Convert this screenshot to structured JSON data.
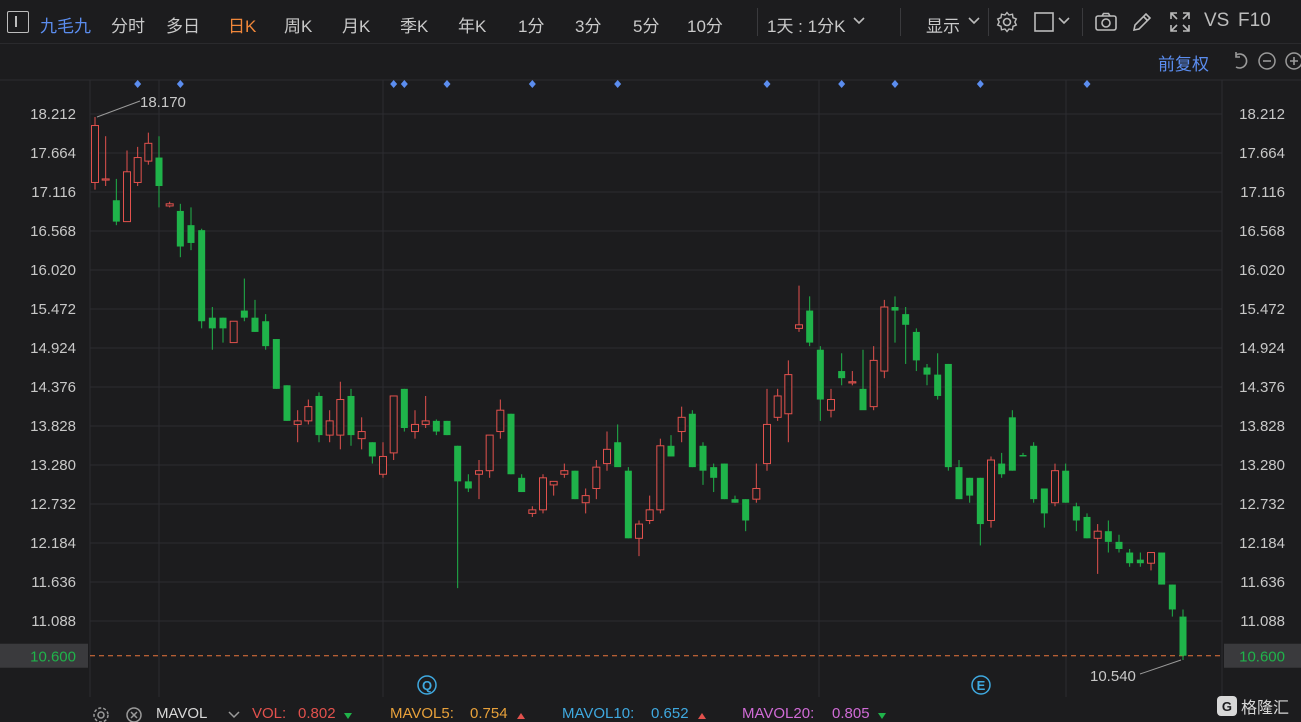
{
  "toolbar": {
    "stock_name": "九毛九",
    "periods": [
      "分时",
      "多日",
      "日K",
      "周K",
      "月K",
      "季K",
      "年K",
      "1分",
      "3分",
      "5分",
      "10分"
    ],
    "active_period": "日K",
    "combo_label": "1天 : 1分K",
    "display_label": "显示",
    "vs_label": "VS",
    "f10_label": "F10"
  },
  "subbar": {
    "adjust_label": "前复权"
  },
  "colors": {
    "up": "#e2514d",
    "down": "#1fb34a",
    "marker": "#5b8def",
    "accent": "#f0873a",
    "price_line": "#e8743b"
  },
  "icons": [
    "sidebar-toggle-icon",
    "chevron-down-icon",
    "gear-icon",
    "square-icon",
    "camera-icon",
    "pencil-icon",
    "fullscreen-icon",
    "undo-icon",
    "minus-circle-icon",
    "plus-circle-icon"
  ],
  "chart_data": {
    "type": "candlestick",
    "y_ticks": [
      "18.212",
      "17.664",
      "17.116",
      "16.568",
      "16.020",
      "15.472",
      "14.924",
      "14.376",
      "13.828",
      "13.280",
      "12.732",
      "12.184",
      "11.636",
      "11.088"
    ],
    "ylim": [
      10.5,
      18.6
    ],
    "last_price": "10.600",
    "high_label": "18.170",
    "low_label": "10.540",
    "event_markers": [
      "Q",
      "E"
    ],
    "candles": [
      {
        "o": 17.25,
        "h": 18.17,
        "l": 17.15,
        "c": 18.05
      },
      {
        "o": 17.3,
        "h": 17.9,
        "l": 17.2,
        "c": 17.3
      },
      {
        "o": 17.0,
        "h": 17.3,
        "l": 16.65,
        "c": 16.7
      },
      {
        "o": 16.7,
        "h": 17.7,
        "l": 16.7,
        "c": 17.4
      },
      {
        "o": 17.25,
        "h": 17.75,
        "l": 17.2,
        "c": 17.6
      },
      {
        "o": 17.55,
        "h": 17.95,
        "l": 17.5,
        "c": 17.8
      },
      {
        "o": 17.6,
        "h": 17.9,
        "l": 16.9,
        "c": 17.2
      },
      {
        "o": 16.92,
        "h": 16.98,
        "l": 16.9,
        "c": 16.95
      },
      {
        "o": 16.85,
        "h": 16.95,
        "l": 16.2,
        "c": 16.35
      },
      {
        "o": 16.65,
        "h": 16.9,
        "l": 16.3,
        "c": 16.4
      },
      {
        "o": 16.58,
        "h": 16.6,
        "l": 15.2,
        "c": 15.3
      },
      {
        "o": 15.35,
        "h": 15.5,
        "l": 14.9,
        "c": 15.2
      },
      {
        "o": 15.35,
        "h": 15.35,
        "l": 15.0,
        "c": 15.2
      },
      {
        "o": 15.0,
        "h": 15.3,
        "l": 15.0,
        "c": 15.3
      },
      {
        "o": 15.45,
        "h": 15.9,
        "l": 15.3,
        "c": 15.35
      },
      {
        "o": 15.35,
        "h": 15.6,
        "l": 15.15,
        "c": 15.15
      },
      {
        "o": 15.3,
        "h": 15.4,
        "l": 14.9,
        "c": 14.95
      },
      {
        "o": 15.05,
        "h": 15.05,
        "l": 14.35,
        "c": 14.35
      },
      {
        "o": 14.4,
        "h": 14.4,
        "l": 13.9,
        "c": 13.9
      },
      {
        "o": 13.85,
        "h": 14.05,
        "l": 13.6,
        "c": 13.9
      },
      {
        "o": 13.9,
        "h": 14.2,
        "l": 13.85,
        "c": 14.1
      },
      {
        "o": 14.25,
        "h": 14.3,
        "l": 13.6,
        "c": 13.7
      },
      {
        "o": 13.7,
        "h": 14.05,
        "l": 13.6,
        "c": 13.9
      },
      {
        "o": 13.7,
        "h": 14.45,
        "l": 13.5,
        "c": 14.2
      },
      {
        "o": 14.25,
        "h": 14.35,
        "l": 13.55,
        "c": 13.7
      },
      {
        "o": 13.65,
        "h": 13.95,
        "l": 13.5,
        "c": 13.75
      },
      {
        "o": 13.6,
        "h": 13.6,
        "l": 13.3,
        "c": 13.4
      },
      {
        "o": 13.15,
        "h": 13.6,
        "l": 13.1,
        "c": 13.4
      },
      {
        "o": 13.45,
        "h": 14.25,
        "l": 13.35,
        "c": 14.25
      },
      {
        "o": 14.35,
        "h": 14.35,
        "l": 13.75,
        "c": 13.8
      },
      {
        "o": 13.75,
        "h": 14.05,
        "l": 13.65,
        "c": 13.85
      },
      {
        "o": 13.85,
        "h": 14.25,
        "l": 13.8,
        "c": 13.9
      },
      {
        "o": 13.9,
        "h": 13.92,
        "l": 13.7,
        "c": 13.75
      },
      {
        "o": 13.9,
        "h": 13.9,
        "l": 13.7,
        "c": 13.7
      },
      {
        "o": 13.55,
        "h": 13.55,
        "l": 11.55,
        "c": 13.05
      },
      {
        "o": 13.05,
        "h": 13.15,
        "l": 12.9,
        "c": 12.95
      },
      {
        "o": 13.15,
        "h": 13.35,
        "l": 12.8,
        "c": 13.2
      },
      {
        "o": 13.2,
        "h": 13.7,
        "l": 13.1,
        "c": 13.7
      },
      {
        "o": 13.75,
        "h": 14.2,
        "l": 13.65,
        "c": 14.05
      },
      {
        "o": 14.0,
        "h": 14.0,
        "l": 13.15,
        "c": 13.15
      },
      {
        "o": 13.1,
        "h": 13.15,
        "l": 12.9,
        "c": 12.9
      },
      {
        "o": 12.6,
        "h": 12.7,
        "l": 12.55,
        "c": 12.65
      },
      {
        "o": 12.65,
        "h": 13.15,
        "l": 12.6,
        "c": 13.1
      },
      {
        "o": 13.0,
        "h": 13.05,
        "l": 12.85,
        "c": 13.05
      },
      {
        "o": 13.15,
        "h": 13.3,
        "l": 13.1,
        "c": 13.2
      },
      {
        "o": 13.2,
        "h": 13.2,
        "l": 12.8,
        "c": 12.8
      },
      {
        "o": 12.75,
        "h": 12.95,
        "l": 12.6,
        "c": 12.85
      },
      {
        "o": 12.95,
        "h": 13.35,
        "l": 12.8,
        "c": 13.25
      },
      {
        "o": 13.3,
        "h": 13.75,
        "l": 13.2,
        "c": 13.5
      },
      {
        "o": 13.6,
        "h": 13.85,
        "l": 13.55,
        "c": 13.25
      },
      {
        "o": 13.2,
        "h": 13.25,
        "l": 12.25,
        "c": 12.25
      },
      {
        "o": 12.25,
        "h": 12.5,
        "l": 12.0,
        "c": 12.45
      },
      {
        "o": 12.5,
        "h": 12.85,
        "l": 12.45,
        "c": 12.65
      },
      {
        "o": 12.65,
        "h": 13.65,
        "l": 12.6,
        "c": 13.55
      },
      {
        "o": 13.55,
        "h": 13.7,
        "l": 13.4,
        "c": 13.4
      },
      {
        "o": 13.75,
        "h": 14.1,
        "l": 13.6,
        "c": 13.95
      },
      {
        "o": 14.0,
        "h": 14.05,
        "l": 13.25,
        "c": 13.25
      },
      {
        "o": 13.55,
        "h": 13.6,
        "l": 13.0,
        "c": 13.2
      },
      {
        "o": 13.25,
        "h": 13.3,
        "l": 12.9,
        "c": 13.1
      },
      {
        "o": 13.3,
        "h": 13.3,
        "l": 12.8,
        "c": 12.8
      },
      {
        "o": 12.8,
        "h": 12.85,
        "l": 12.75,
        "c": 12.75
      },
      {
        "o": 12.8,
        "h": 12.8,
        "l": 12.35,
        "c": 12.5
      },
      {
        "o": 12.8,
        "h": 13.3,
        "l": 12.75,
        "c": 12.95
      },
      {
        "o": 13.3,
        "h": 14.35,
        "l": 13.2,
        "c": 13.85
      },
      {
        "o": 13.95,
        "h": 14.35,
        "l": 13.9,
        "c": 14.25
      },
      {
        "o": 14.0,
        "h": 14.75,
        "l": 13.6,
        "c": 14.55
      },
      {
        "o": 15.2,
        "h": 15.8,
        "l": 15.15,
        "c": 15.25
      },
      {
        "o": 15.45,
        "h": 15.65,
        "l": 14.95,
        "c": 15.0
      },
      {
        "o": 14.9,
        "h": 14.95,
        "l": 13.9,
        "c": 14.2
      },
      {
        "o": 14.05,
        "h": 14.35,
        "l": 13.95,
        "c": 14.2
      },
      {
        "o": 14.6,
        "h": 14.85,
        "l": 14.4,
        "c": 14.5
      },
      {
        "o": 14.45,
        "h": 14.6,
        "l": 14.4,
        "c": 14.45
      },
      {
        "o": 14.35,
        "h": 14.9,
        "l": 14.1,
        "c": 14.05
      },
      {
        "o": 14.1,
        "h": 14.95,
        "l": 14.05,
        "c": 14.75
      },
      {
        "o": 14.6,
        "h": 15.6,
        "l": 14.5,
        "c": 15.5
      },
      {
        "o": 15.5,
        "h": 15.65,
        "l": 15.0,
        "c": 15.45
      },
      {
        "o": 15.4,
        "h": 15.5,
        "l": 14.7,
        "c": 15.25
      },
      {
        "o": 15.15,
        "h": 15.2,
        "l": 14.6,
        "c": 14.75
      },
      {
        "o": 14.65,
        "h": 14.7,
        "l": 14.4,
        "c": 14.55
      },
      {
        "o": 14.55,
        "h": 14.85,
        "l": 14.2,
        "c": 14.25
      },
      {
        "o": 14.7,
        "h": 14.7,
        "l": 13.2,
        "c": 13.25
      },
      {
        "o": 13.25,
        "h": 13.35,
        "l": 12.8,
        "c": 12.8
      },
      {
        "o": 13.1,
        "h": 13.1,
        "l": 12.75,
        "c": 12.85
      },
      {
        "o": 13.1,
        "h": 13.1,
        "l": 12.15,
        "c": 12.45
      },
      {
        "o": 12.5,
        "h": 13.4,
        "l": 12.4,
        "c": 13.35
      },
      {
        "o": 13.3,
        "h": 13.45,
        "l": 13.1,
        "c": 13.15
      },
      {
        "o": 13.95,
        "h": 14.05,
        "l": 13.2,
        "c": 13.2
      },
      {
        "o": 13.42,
        "h": 13.45,
        "l": 13.4,
        "c": 13.4
      },
      {
        "o": 13.55,
        "h": 13.6,
        "l": 12.75,
        "c": 12.8
      },
      {
        "o": 12.95,
        "h": 12.95,
        "l": 12.4,
        "c": 12.6
      },
      {
        "o": 12.75,
        "h": 13.3,
        "l": 12.7,
        "c": 13.2
      },
      {
        "o": 13.2,
        "h": 13.3,
        "l": 12.75,
        "c": 12.75
      },
      {
        "o": 12.7,
        "h": 12.75,
        "l": 12.35,
        "c": 12.5
      },
      {
        "o": 12.55,
        "h": 12.6,
        "l": 12.25,
        "c": 12.25
      },
      {
        "o": 12.25,
        "h": 12.45,
        "l": 11.75,
        "c": 12.35
      },
      {
        "o": 12.35,
        "h": 12.5,
        "l": 12.05,
        "c": 12.2
      },
      {
        "o": 12.2,
        "h": 12.3,
        "l": 12.05,
        "c": 12.1
      },
      {
        "o": 12.05,
        "h": 12.1,
        "l": 11.85,
        "c": 11.9
      },
      {
        "o": 11.95,
        "h": 12.05,
        "l": 11.85,
        "c": 11.9
      },
      {
        "o": 11.9,
        "h": 12.05,
        "l": 11.8,
        "c": 12.05
      },
      {
        "o": 12.05,
        "h": 12.05,
        "l": 11.6,
        "c": 11.6
      },
      {
        "o": 11.6,
        "h": 11.6,
        "l": 11.15,
        "c": 11.25
      },
      {
        "o": 11.15,
        "h": 11.25,
        "l": 10.54,
        "c": 10.6
      }
    ],
    "marker_candles": [
      4,
      8,
      28,
      29,
      33,
      41,
      49,
      63,
      70,
      75,
      83,
      93
    ]
  },
  "indicators": {
    "name": "MAVOL",
    "vol_label": "VOL:",
    "vol_value": "0.802",
    "mavol5_label": "MAVOL5:",
    "mavol5_value": "0.754",
    "mavol10_label": "MAVOL10:",
    "mavol10_value": "0.652",
    "mavol20_label": "MAVOL20:",
    "mavol20_value": "0.805"
  },
  "watermark": {
    "brand": "格隆汇"
  }
}
